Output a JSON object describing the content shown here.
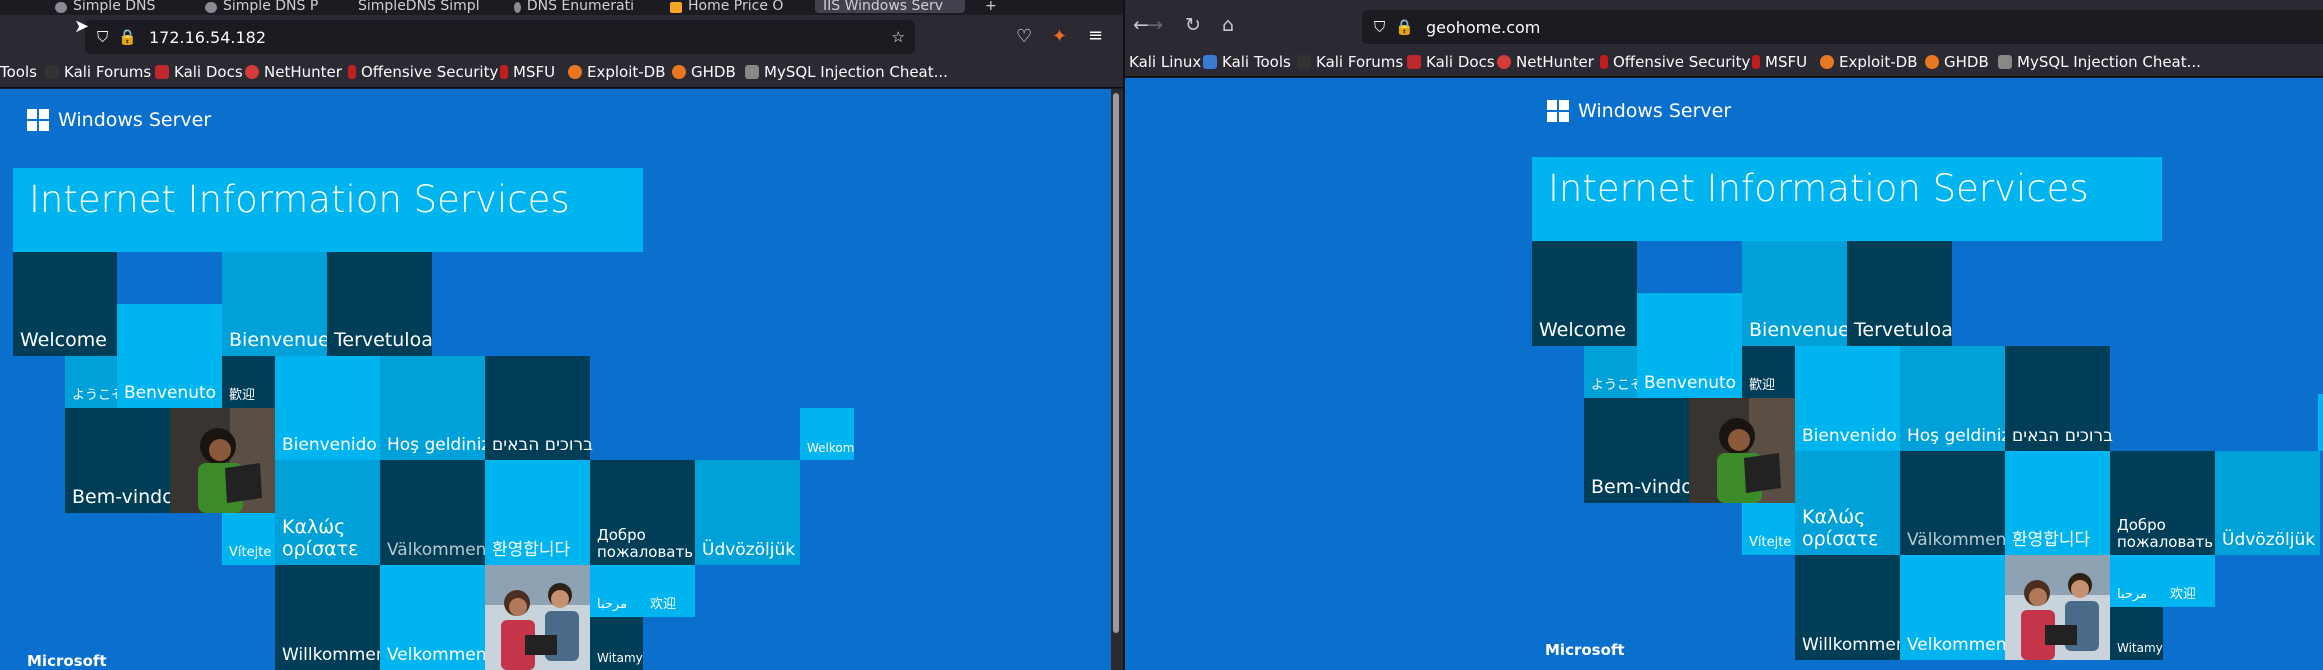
{
  "left_window": {
    "tabs": [
      "Simple DNS",
      "Simple DNS P",
      "SimpleDNS Simpl",
      "DNS Enumerati",
      "Home Price O",
      "IIS Windows Serv"
    ],
    "url": "172.16.54.182",
    "bookmarks": [
      "Tools",
      "Kali Forums",
      "Kali Docs",
      "NetHunter",
      "Offensive Security",
      "MSFU",
      "Exploit-DB",
      "GHDB",
      "MySQL Injection Cheat..."
    ]
  },
  "right_window": {
    "url": "geohome.com",
    "bookmarks": [
      "Kali Linux",
      "Kali Tools",
      "Kali Forums",
      "Kali Docs",
      "NetHunter",
      "Offensive Security",
      "MSFU",
      "Exploit-DB",
      "GHDB",
      "MySQL Injection Cheat..."
    ]
  },
  "iis": {
    "brand": "Windows Server",
    "title": "Internet Information Services",
    "footer": "Microsoft",
    "greetings": {
      "welcome": "Welcome",
      "bienvenue": "Bienvenue",
      "tervetuloa": "Tervetuloa",
      "yokoso": "ようこそ",
      "benvenuto": "Benvenuto",
      "huanying_trad": "歡迎",
      "bienvenido": "Bienvenido",
      "hos_geldiniz": "Hoş geldiniz",
      "hebrew": "ברוכים הבאים",
      "welkom": "Welkom",
      "bem_vindo": "Bem-vindo",
      "vitejte": "Vítejte",
      "kalos_line1": "Καλώς",
      "kalos_line2": "ορίσατε",
      "valkommen": "Välkommen",
      "korean": "환영합니다",
      "dobro_line1": "Добро",
      "dobro_line2": "пожаловать",
      "udvozoljuk": "Üdvözöljük",
      "marhaba": "مرحبا",
      "huanying_simp": "欢迎",
      "willkommen": "Willkommen",
      "velkommen": "Velkommen",
      "witamy": "Witamy"
    }
  },
  "colors": {
    "page_bg": "#0a6fcd",
    "tile_dark": "#003e58",
    "tile_cyan": "#00b4ef",
    "tile_teal": "#00a0d8",
    "firefox_chrome": "#2b2a33"
  }
}
